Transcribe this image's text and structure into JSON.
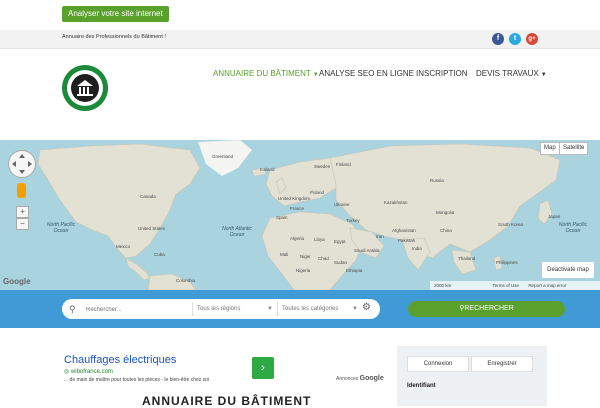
{
  "topbar": {
    "analyse_button": "Analyser votre site internet"
  },
  "infobar": {
    "tagline": "Annuaire des Professionnels du Bâtiment !",
    "social": {
      "facebook": "f",
      "twitter": "t",
      "googleplus": "g+"
    }
  },
  "nav": [
    {
      "label": "ANNUAIRE DU BÂTIMENT",
      "active": true,
      "has_dropdown": true
    },
    {
      "label": "ANALYSE SEO EN LIGNE",
      "active": false,
      "has_dropdown": false
    },
    {
      "label": "INSCRIPTION",
      "active": false,
      "has_dropdown": false
    },
    {
      "label": "DEVIS TRAVAUX",
      "active": false,
      "has_dropdown": true
    }
  ],
  "map": {
    "type_map": "Map",
    "type_satellite": "Satellite",
    "deactivate": "Deactivate map",
    "google": "Google",
    "footer_scale": "2000 km",
    "footer_terms": "Terms of Use",
    "footer_report": "Report a map error",
    "oceans": {
      "north_pacific": "North Pacific Ocean",
      "north_atlantic": "North Atlantic Ocean",
      "north_pacific_east": "North Pacific Ocean"
    },
    "places": [
      "Greenland",
      "Iceland",
      "Sweden",
      "Finland",
      "Canada",
      "United Kingdom",
      "Poland",
      "Ukraine",
      "Kazakhstan",
      "Mongolia",
      "Russia",
      "United States",
      "France",
      "Spain",
      "Turkey",
      "China",
      "Japan",
      "South Korea",
      "Algeria",
      "Libya",
      "Egypt",
      "Saudi Arabia",
      "Iran",
      "Afghanistan",
      "Pakistan",
      "India",
      "Mexico",
      "Cuba",
      "Mali",
      "Niger",
      "Chad",
      "Sudan",
      "Ethiopia",
      "Nigeria",
      "Colombia",
      "Thailand",
      "Philippines"
    ],
    "zoom_in": "+",
    "zoom_out": "−"
  },
  "search": {
    "placeholder": "Rechercher...",
    "regions": "Tous les régions",
    "categories": "Toutes les catégories",
    "button": "RECHERCHER"
  },
  "ad": {
    "title": "Chauffages électriques",
    "url": "wibofrance.com",
    "text": "... de main de maître pour toutes les pièces - le bien-être chez soi",
    "label_prefix": "Annonces",
    "label_brand": "Google",
    "arrow": "›"
  },
  "main": {
    "heading": "ANNUAIRE DU BÂTIMENT"
  },
  "sidebar": {
    "tab_login": "Connexion",
    "tab_register": "Enregistrer",
    "identifiant": "Identifiant"
  },
  "colors": {
    "accent_green": "#5aa02c",
    "search_blue": "#3f9ad6",
    "ocean": "#a9d3df",
    "link_blue": "#1a55c5"
  }
}
